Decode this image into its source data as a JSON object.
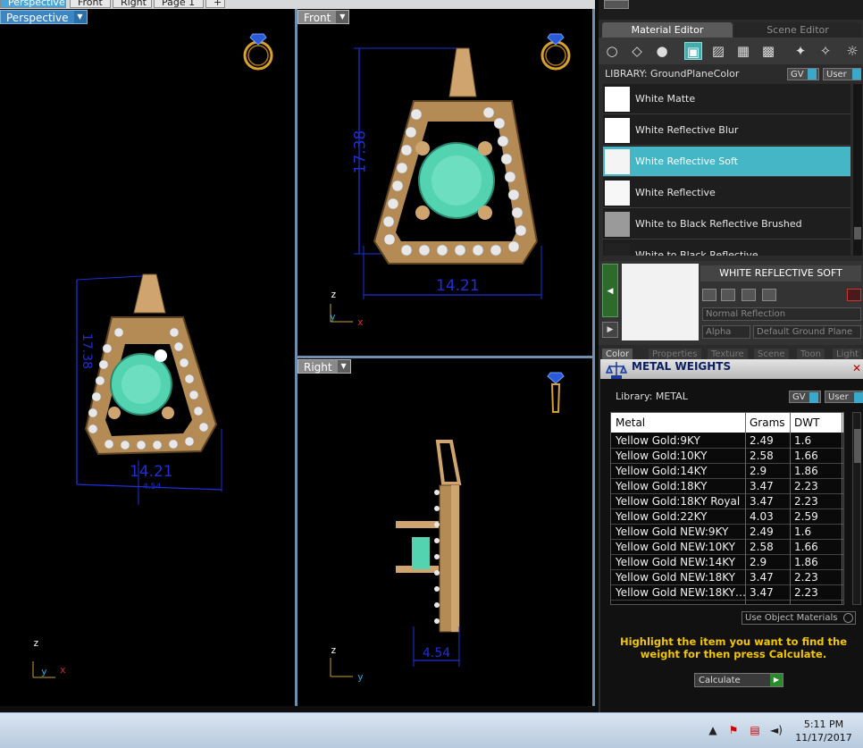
{
  "viewport_tabs": [
    "Perspective",
    "Front",
    "Right",
    "Page 1",
    "+"
  ],
  "viewports": {
    "perspective": {
      "label": "Perspective",
      "dim_height": "17.38",
      "dim_width": "14.21",
      "dim_small": "4.54",
      "axis": {
        "z": "z",
        "y": "y",
        "x": "x"
      }
    },
    "front": {
      "label": "Front",
      "dim_height": "17.38",
      "dim_width": "14.21",
      "axis": {
        "z": "z",
        "y": "y",
        "x": "x"
      }
    },
    "right": {
      "label": "Right",
      "dim_width": "4.54",
      "axis": {
        "z": "z",
        "y": "y"
      }
    }
  },
  "material_editor": {
    "tabs": [
      "Material Editor",
      "Scene Editor"
    ],
    "library_label": "LIBRARY: GroundPlaneColor",
    "gv_label": "GV",
    "user_label": "User",
    "materials": [
      {
        "name": "White Matte",
        "swatch": "#ffffff"
      },
      {
        "name": "White Reflective Blur",
        "swatch": "#ffffff"
      },
      {
        "name": "White Reflective Soft",
        "swatch": "#f4f4f4",
        "selected": true
      },
      {
        "name": "White Reflective",
        "swatch": "#f7f7f7"
      },
      {
        "name": "White to Black Reflective Brushed",
        "swatch": "#9a9a9a"
      },
      {
        "name": "White to Black Reflective",
        "swatch": "#222222"
      }
    ],
    "selected_title": "WHITE REFLECTIVE SOFT",
    "reflection_mode": "Normal Reflection",
    "alpha_label": "Alpha",
    "ground_plane": "Default Ground Plane",
    "bottom_tabs": [
      "Color",
      "Properties",
      "Texture",
      "Scene",
      "Toon",
      "Light"
    ]
  },
  "metal_weights": {
    "title": "METAL WEIGHTS",
    "library_label": "Library: METAL",
    "gv_label": "GV",
    "user_label": "User",
    "columns": [
      "Metal",
      "Grams",
      "DWT"
    ],
    "rows": [
      [
        "Yellow Gold:9KY",
        "2.49",
        "1.6"
      ],
      [
        "Yellow Gold:10KY",
        "2.58",
        "1.66"
      ],
      [
        "Yellow Gold:14KY",
        "2.9",
        "1.86"
      ],
      [
        "Yellow Gold:18KY",
        "3.47",
        "2.23"
      ],
      [
        "Yellow Gold:18KY Royal",
        "3.47",
        "2.23"
      ],
      [
        "Yellow Gold:22KY",
        "4.03",
        "2.59"
      ],
      [
        "Yellow Gold NEW:9KY",
        "2.49",
        "1.6"
      ],
      [
        "Yellow Gold NEW:10KY",
        "2.58",
        "1.66"
      ],
      [
        "Yellow Gold NEW:14KY",
        "2.9",
        "1.86"
      ],
      [
        "Yellow Gold NEW:18KY",
        "3.47",
        "2.23"
      ],
      [
        "Yellow Gold NEW:18KY…",
        "3.47",
        "2.23"
      ]
    ],
    "use_object_materials": "Use Object Materials",
    "hint": "Highlight the item you want to find the weight for then press Calculate.",
    "calculate_label": "Calculate"
  },
  "taskbar": {
    "time": "5:11 PM",
    "date": "11/17/2017"
  }
}
